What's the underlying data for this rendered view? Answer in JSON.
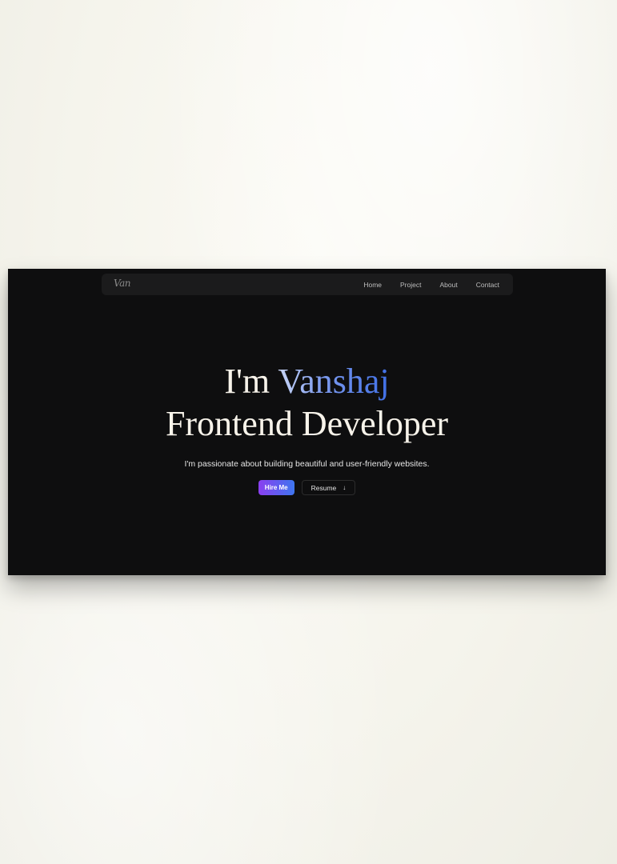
{
  "nav": {
    "logo": "Van",
    "links": [
      "Home",
      "Project",
      "About",
      "Contact"
    ]
  },
  "hero": {
    "greeting": "I'm ",
    "name": "Vanshaj",
    "role": "Frontend Developer",
    "tagline": "I'm passionate about building beautiful and user-friendly websites.",
    "hire_label": "Hire Me",
    "resume_label": "Resume",
    "resume_icon": "arrow-down-icon"
  },
  "colors": {
    "page_background": "#f5f4ec",
    "site_background": "#0e0e0f",
    "nav_background": "#1b1b1c",
    "heading_text": "#f7f3ea",
    "name_gradient_start": "#c9d6f5",
    "name_gradient_end": "#3f6fe6",
    "primary_button_start": "#8b3ff0",
    "primary_button_end": "#3e76ef"
  }
}
